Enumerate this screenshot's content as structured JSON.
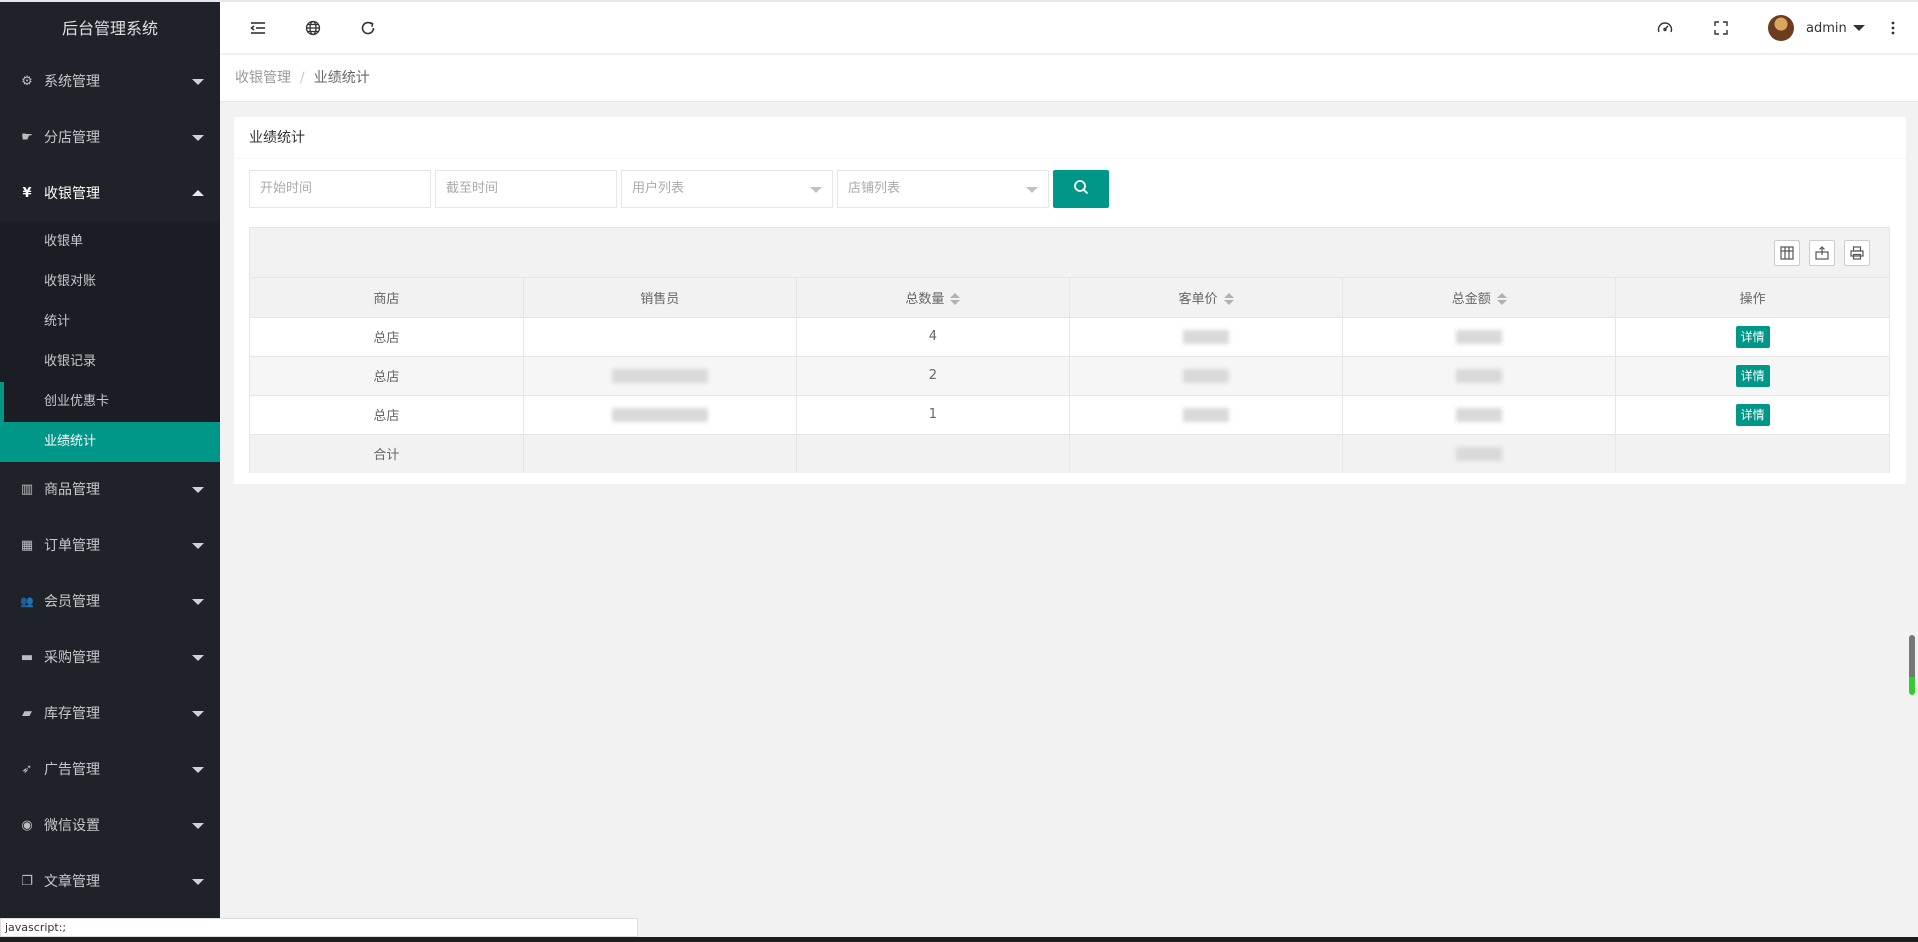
{
  "app": {
    "title": "后台管理系统"
  },
  "sidebar": {
    "items": [
      {
        "label": "系统管理",
        "icon": "gear-icon",
        "glyph": "⚙"
      },
      {
        "label": "分店管理",
        "icon": "hand-icon",
        "glyph": "☛"
      },
      {
        "label": "收银管理",
        "icon": "yen-icon",
        "glyph": "¥"
      },
      {
        "label": "商品管理",
        "icon": "bar-chart-icon",
        "glyph": "▥"
      },
      {
        "label": "订单管理",
        "icon": "calendar-icon",
        "glyph": "▦"
      },
      {
        "label": "会员管理",
        "icon": "users-icon",
        "glyph": "👥"
      },
      {
        "label": "采购管理",
        "icon": "briefcase-icon",
        "glyph": "▬"
      },
      {
        "label": "库存管理",
        "icon": "folder-icon",
        "glyph": "▰"
      },
      {
        "label": "广告管理",
        "icon": "rocket-icon",
        "glyph": "➶"
      },
      {
        "label": "微信设置",
        "icon": "wechat-icon",
        "glyph": "◉"
      },
      {
        "label": "文章管理",
        "icon": "copy-icon",
        "glyph": "❐"
      }
    ],
    "sub_items": [
      "收银单",
      "收银对账",
      "统计",
      "收银记录",
      "创业优惠卡",
      "业绩统计"
    ]
  },
  "header": {
    "icons": [
      "menu-toggle-icon",
      "globe-icon",
      "refresh-icon",
      "theme-icon",
      "fullscreen-icon",
      "more-icon"
    ],
    "username": "admin"
  },
  "breadcrumb": {
    "parent": "收银管理",
    "separator": "/",
    "current": "业绩统计"
  },
  "card": {
    "title": "业绩统计"
  },
  "filters": {
    "start_placeholder": "开始时间",
    "end_placeholder": "截至时间",
    "user_placeholder": "用户列表",
    "shop_placeholder": "店铺列表"
  },
  "table": {
    "columns": [
      "商店",
      "销售员",
      "总数量",
      "客单价",
      "总金额",
      "操作"
    ],
    "rows": [
      {
        "shop": "总店",
        "qty": "4",
        "action": "详情"
      },
      {
        "shop": "总店",
        "qty": "2",
        "action": "详情"
      },
      {
        "shop": "总店",
        "qty": "1",
        "action": "详情"
      }
    ],
    "total_label": "合计"
  },
  "statusbar": {
    "text": "javascript:;"
  },
  "colors": {
    "accent": "#009688",
    "sidebar_bg": "#20222a"
  }
}
